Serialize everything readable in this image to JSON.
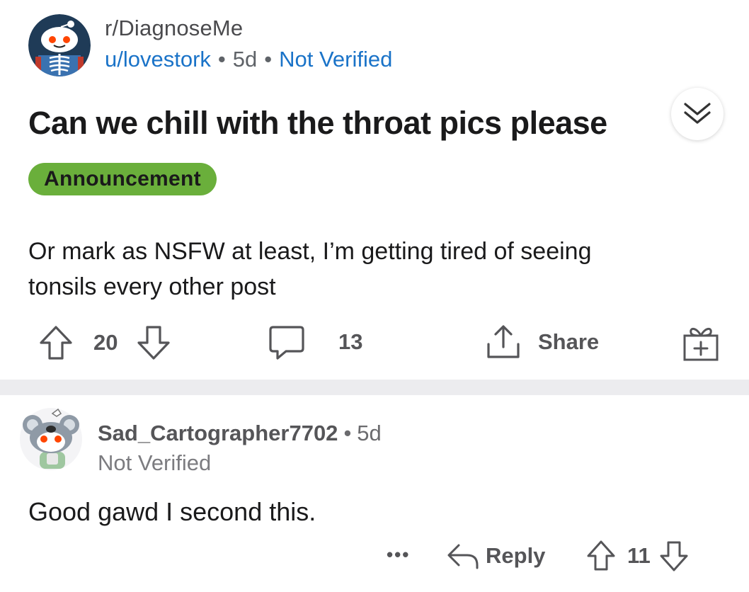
{
  "post": {
    "subreddit": "r/DiagnoseMe",
    "author": "u/lovestork",
    "separator": "•",
    "age": "5d",
    "verification": "Not Verified",
    "title": "Can we chill with the throat pics please",
    "flair": "Announcement",
    "body": "Or mark as NSFW at least, I’m getting tired of seeing tonsils every other post",
    "upvotes": "20",
    "comments": "13",
    "share_label": "Share"
  },
  "comment": {
    "author": "Sad_Cartographer7702",
    "separator": "•",
    "age": "5d",
    "verification": "Not Verified",
    "body": "Good gawd I second this.",
    "more_label": "•••",
    "reply_label": "Reply",
    "score": "11"
  },
  "colors": {
    "link_blue": "#1a73c8",
    "flair_green": "#6aaf3b",
    "divider_gray": "#ececef",
    "icon_gray": "#555558"
  },
  "icons": {
    "expand": "double-chevron-down-icon",
    "upvote": "arrow-up-icon",
    "downvote": "arrow-down-icon",
    "comment": "speech-bubble-icon",
    "share": "share-icon",
    "award": "gift-icon",
    "reply": "reply-arrow-icon"
  }
}
